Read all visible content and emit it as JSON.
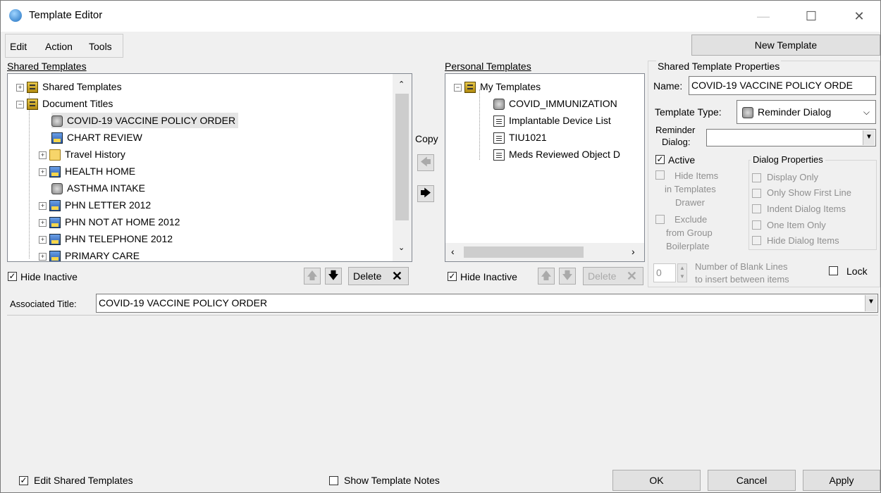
{
  "window": {
    "title": "Template Editor",
    "minimize": "—",
    "maximize": "☐",
    "close": "✕"
  },
  "menu": {
    "items": [
      "Edit",
      "Action",
      "Tools"
    ]
  },
  "new_template_button": "New Template",
  "shared": {
    "header": "Shared Templates",
    "tree": [
      {
        "label": "Shared Templates",
        "icon": "cabinet-icon",
        "expander": "+"
      },
      {
        "label": "Document Titles",
        "icon": "cabinet-icon",
        "expander": "−"
      },
      {
        "label": "COVID-19 VACCINE POLICY ORDER",
        "icon": "reminder-dialog-icon",
        "expander": "",
        "selected": true
      },
      {
        "label": "CHART REVIEW",
        "icon": "dialog-icon",
        "expander": ""
      },
      {
        "label": "Travel History",
        "icon": "folder-icon",
        "expander": "+"
      },
      {
        "label": "HEALTH HOME",
        "icon": "dialog-icon",
        "expander": "+"
      },
      {
        "label": "ASTHMA INTAKE",
        "icon": "reminder-dialog-icon",
        "expander": ""
      },
      {
        "label": "PHN LETTER 2012",
        "icon": "dialog-icon",
        "expander": "+"
      },
      {
        "label": "PHN NOT AT HOME 2012",
        "icon": "dialog-icon",
        "expander": "+"
      },
      {
        "label": "PHN TELEPHONE 2012",
        "icon": "dialog-icon",
        "expander": "+"
      },
      {
        "label": "PRIMARY CARE",
        "icon": "dialog-icon",
        "expander": "+"
      }
    ],
    "hide_inactive": "Hide Inactive",
    "delete": "Delete"
  },
  "copy": {
    "label": "Copy"
  },
  "personal": {
    "header": "Personal Templates",
    "tree": [
      {
        "label": "My Templates",
        "icon": "cabinet-icon",
        "expander": "−"
      },
      {
        "label": "COVID_IMMUNIZATION",
        "icon": "reminder-dialog-icon"
      },
      {
        "label": "Implantable Device List",
        "icon": "document-icon"
      },
      {
        "label": "TIU1021",
        "icon": "document-icon"
      },
      {
        "label": "Meds Reviewed Object D",
        "icon": "document-icon"
      }
    ],
    "hide_inactive": "Hide Inactive",
    "delete": "Delete"
  },
  "properties": {
    "header": "Shared Template Properties",
    "name_label": "Name:",
    "name_value": "COVID-19 VACCINE POLICY ORDE",
    "type_label": "Template Type:",
    "type_value": "Reminder Dialog",
    "reminder_label_1": "Reminder",
    "reminder_label_2": "Dialog:",
    "reminder_value": "",
    "active": "Active",
    "hide_items": [
      "Hide Items",
      "in Templates",
      "Drawer"
    ],
    "exclude": [
      "Exclude",
      "from Group",
      "Boilerplate"
    ],
    "dialog_props_header": "Dialog Properties",
    "dialog_props": [
      "Display Only",
      "Only Show First Line",
      "Indent Dialog Items",
      "One Item Only",
      "Hide Dialog Items"
    ],
    "blank_lines_value": "0",
    "blank_lines_label_1": "Number of Blank Lines",
    "blank_lines_label_2": "to insert between items",
    "lock": "Lock"
  },
  "associated": {
    "label": "Associated Title:",
    "value": "COVID-19 VACCINE POLICY ORDER"
  },
  "footer": {
    "edit_shared": "Edit Shared Templates",
    "show_notes": "Show Template Notes",
    "ok": "OK",
    "cancel": "Cancel",
    "apply": "Apply"
  }
}
